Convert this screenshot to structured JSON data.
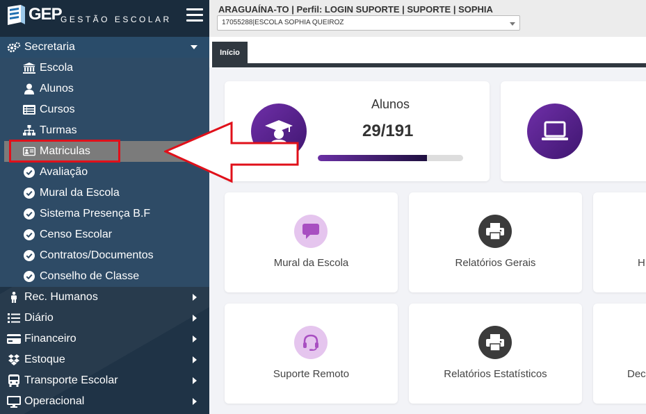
{
  "brand": {
    "name": "GEP",
    "subtitle": "GESTÃO ESCOLAR"
  },
  "header": {
    "context": "ARAGUAÍNA-TO | Perfil: LOGIN SUPORTE | SUPORTE | SOPHIA",
    "school_selected": "17055288|ESCOLA SOPHIA QUEIROZ"
  },
  "tabs": [
    {
      "label": "Início"
    }
  ],
  "sidebar": {
    "secretaria": {
      "label": "Secretaria",
      "items": [
        {
          "label": "Escola",
          "icon": "institution-icon"
        },
        {
          "label": "Alunos",
          "icon": "user-icon"
        },
        {
          "label": "Cursos",
          "icon": "list-icon"
        },
        {
          "label": "Turmas",
          "icon": "sitemap-icon"
        },
        {
          "label": "Matriculas",
          "icon": "id-card-icon"
        },
        {
          "label": "Avaliação",
          "icon": "check-circle-icon"
        },
        {
          "label": "Mural da Escola",
          "icon": "check-circle-icon"
        },
        {
          "label": "Sistema Presença B.F",
          "icon": "check-circle-icon"
        },
        {
          "label": "Censo Escolar",
          "icon": "check-circle-icon"
        },
        {
          "label": "Contratos/Documentos",
          "icon": "check-circle-icon"
        },
        {
          "label": "Conselho de Classe",
          "icon": "check-circle-icon"
        }
      ]
    },
    "sections": [
      {
        "label": "Rec. Humanos",
        "icon": "male-icon"
      },
      {
        "label": "Diário",
        "icon": "list-ol-icon"
      },
      {
        "label": "Financeiro",
        "icon": "credit-card-icon"
      },
      {
        "label": "Estoque",
        "icon": "dropbox-icon"
      },
      {
        "label": "Transporte Escolar",
        "icon": "bus-icon"
      },
      {
        "label": "Operacional",
        "icon": "desktop-icon"
      }
    ]
  },
  "stats": {
    "alunos": {
      "label": "Alunos",
      "value": "29/191",
      "progress": 0.75
    }
  },
  "tiles": [
    {
      "label": "Mural da Escola",
      "icon": "comment-icon"
    },
    {
      "label": "Relatórios Gerais",
      "icon": "print-icon"
    },
    {
      "label": "H",
      "icon": ""
    },
    {
      "label": "Suporte Remoto",
      "icon": "headset-icon"
    },
    {
      "label": "Relatórios Estatísticos",
      "icon": "print-icon"
    },
    {
      "label": "Dec",
      "icon": ""
    }
  ],
  "colors": {
    "sidebar": "#1f3346",
    "accent_purple": "#5b2593",
    "highlight_red": "#e0101a"
  }
}
